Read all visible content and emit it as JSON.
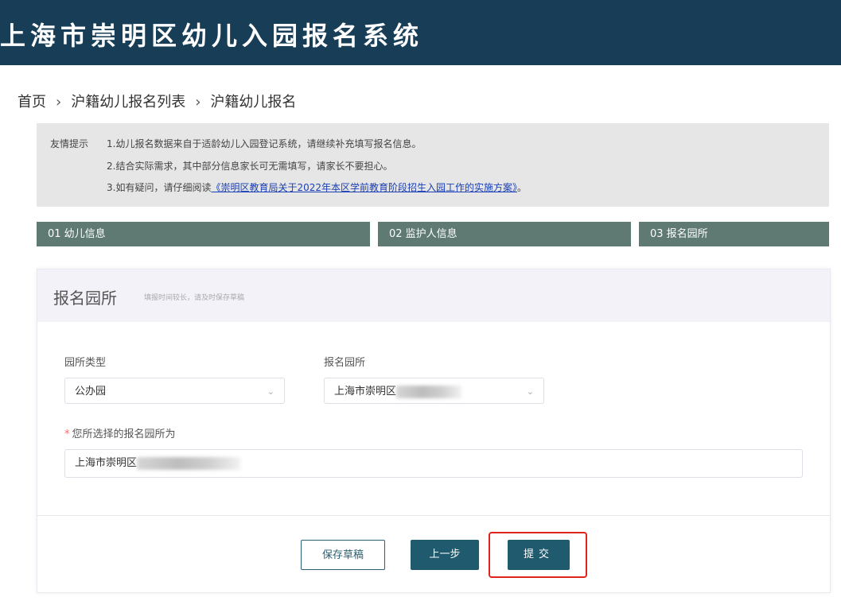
{
  "header": {
    "title": "上海市崇明区幼儿入园报名系统"
  },
  "breadcrumb": {
    "items": [
      "首页",
      "沪籍幼儿报名列表",
      "沪籍幼儿报名"
    ],
    "separator": "›"
  },
  "notice": {
    "label": "友情提示",
    "line1": "1.幼儿报名数据来自于适龄幼儿入园登记系统，请继续补充填写报名信息。",
    "line2": "2.结合实际需求，其中部分信息家长可无需填写，请家长不要担心。",
    "line3_prefix": "3.如有疑问，请仔细阅读",
    "line3_link": "《崇明区教育局关于2022年本区学前教育阶段招生入园工作的实施方案》",
    "line3_suffix": "。"
  },
  "steps": [
    {
      "label": "01 幼儿信息"
    },
    {
      "label": "02 监护人信息"
    },
    {
      "label": "03 报名园所"
    }
  ],
  "card": {
    "title": "报名园所",
    "subtitle": "填报时间较长，请及时保存草稿"
  },
  "form": {
    "type_label": "园所类型",
    "type_value": "公办园",
    "school_label": "报名园所",
    "school_value": "上海市崇明区",
    "selected_label": "您所选择的报名园所为",
    "selected_value": "上海市崇明区"
  },
  "buttons": {
    "draft": "保存草稿",
    "prev": "上一步",
    "submit": "提交"
  },
  "colors": {
    "header_bg": "#173d57",
    "step_bg": "#5f7a72",
    "button_bg": "#1f5a6e",
    "highlight": "#e0231f"
  }
}
